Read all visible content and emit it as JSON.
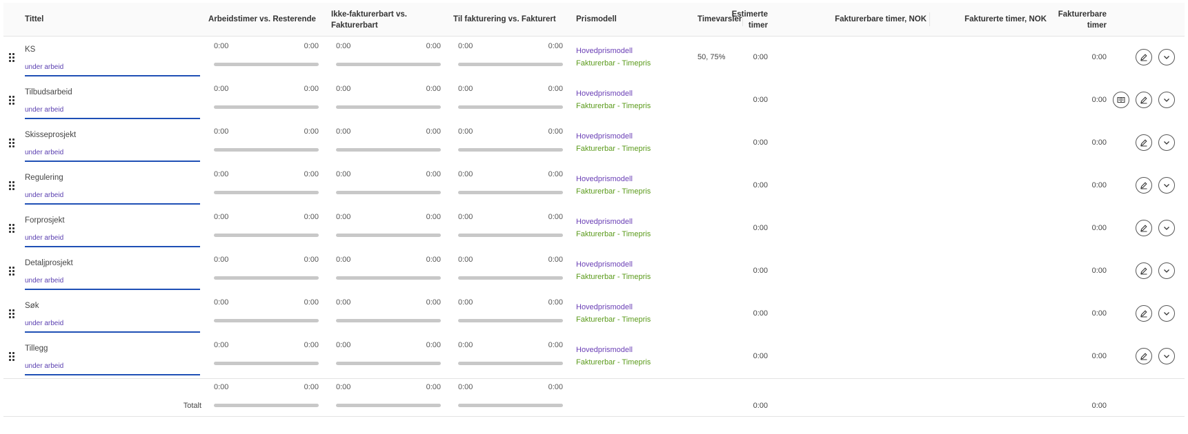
{
  "header": {
    "tittel": "Tittel",
    "arbeidstimer": "Arbeidstimer vs. Resterende",
    "ikke_fakturerbart_1": "Ikke-fakturerbart vs.",
    "ikke_fakturerbart_2": "Fakturerbart",
    "til_fakturering": "Til fakturering vs. Fakturert",
    "prismodell": "Prismodell",
    "timevarsler": "Timevarsler",
    "estimerte_1": "Estimerte",
    "estimerte_2": "timer",
    "fakturerbare_nok": "Fakturerbare timer, NOK",
    "fakturerte_nok": "Fakturerte timer, NOK",
    "fakturerbare_1": "Fakturerbare",
    "fakturerbare_2": "timer"
  },
  "rows": [
    {
      "title": "KS",
      "status": "under arbeid",
      "a_l": "0:00",
      "a_r": "0:00",
      "b_l": "0:00",
      "b_r": "0:00",
      "c_l": "0:00",
      "c_r": "0:00",
      "pm1": "Hovedprismodell",
      "pm2": "Fakturerbar - Timepris",
      "timevarsler": "50, 75%",
      "est": "0:00",
      "fb": "0:00"
    },
    {
      "title": "Tilbudsarbeid",
      "status": "under arbeid",
      "a_l": "0:00",
      "a_r": "0:00",
      "b_l": "0:00",
      "b_r": "0:00",
      "c_l": "0:00",
      "c_r": "0:00",
      "pm1": "Hovedprismodell",
      "pm2": "Fakturerbar - Timepris",
      "timevarsler": "",
      "est": "0:00",
      "fb": "0:00"
    },
    {
      "title": "Skisseprosjekt",
      "status": "under arbeid",
      "a_l": "0:00",
      "a_r": "0:00",
      "b_l": "0:00",
      "b_r": "0:00",
      "c_l": "0:00",
      "c_r": "0:00",
      "pm1": "Hovedprismodell",
      "pm2": "Fakturerbar - Timepris",
      "timevarsler": "",
      "est": "0:00",
      "fb": "0:00"
    },
    {
      "title": "Regulering",
      "status": "under arbeid",
      "a_l": "0:00",
      "a_r": "0:00",
      "b_l": "0:00",
      "b_r": "0:00",
      "c_l": "0:00",
      "c_r": "0:00",
      "pm1": "Hovedprismodell",
      "pm2": "Fakturerbar - Timepris",
      "timevarsler": "",
      "est": "0:00",
      "fb": "0:00"
    },
    {
      "title": "Forprosjekt",
      "status": "under arbeid",
      "a_l": "0:00",
      "a_r": "0:00",
      "b_l": "0:00",
      "b_r": "0:00",
      "c_l": "0:00",
      "c_r": "0:00",
      "pm1": "Hovedprismodell",
      "pm2": "Fakturerbar - Timepris",
      "timevarsler": "",
      "est": "0:00",
      "fb": "0:00"
    },
    {
      "title": "Detaljprosjekt",
      "status": "under arbeid",
      "a_l": "0:00",
      "a_r": "0:00",
      "b_l": "0:00",
      "b_r": "0:00",
      "c_l": "0:00",
      "c_r": "0:00",
      "pm1": "Hovedprismodell",
      "pm2": "Fakturerbar - Timepris",
      "timevarsler": "",
      "est": "0:00",
      "fb": "0:00"
    },
    {
      "title": "Søk",
      "status": "under arbeid",
      "a_l": "0:00",
      "a_r": "0:00",
      "b_l": "0:00",
      "b_r": "0:00",
      "c_l": "0:00",
      "c_r": "0:00",
      "pm1": "Hovedprismodell",
      "pm2": "Fakturerbar - Timepris",
      "timevarsler": "",
      "est": "0:00",
      "fb": "0:00"
    },
    {
      "title": "Tillegg",
      "status": "under arbeid",
      "a_l": "0:00",
      "a_r": "0:00",
      "b_l": "0:00",
      "b_r": "0:00",
      "c_l": "0:00",
      "c_r": "0:00",
      "pm1": "Hovedprismodell",
      "pm2": "Fakturerbar - Timepris",
      "timevarsler": "",
      "est": "0:00",
      "fb": "0:00"
    }
  ],
  "totals": {
    "label": "Totalt",
    "a_l": "0:00",
    "a_r": "0:00",
    "b_l": "0:00",
    "b_r": "0:00",
    "c_l": "0:00",
    "c_r": "0:00",
    "est": "0:00",
    "fb": "0:00"
  },
  "icons": {
    "drag": "drag-handle-icon",
    "edit": "pencil-icon",
    "expand": "chevron-down-icon",
    "book": "book-icon"
  },
  "colors": {
    "status": "#5a3fb0",
    "underline": "#1e4fb5",
    "prismodell": "#6a3fb5",
    "fakturerbar": "#5a9a1a",
    "bar": "#c8c8c8"
  }
}
